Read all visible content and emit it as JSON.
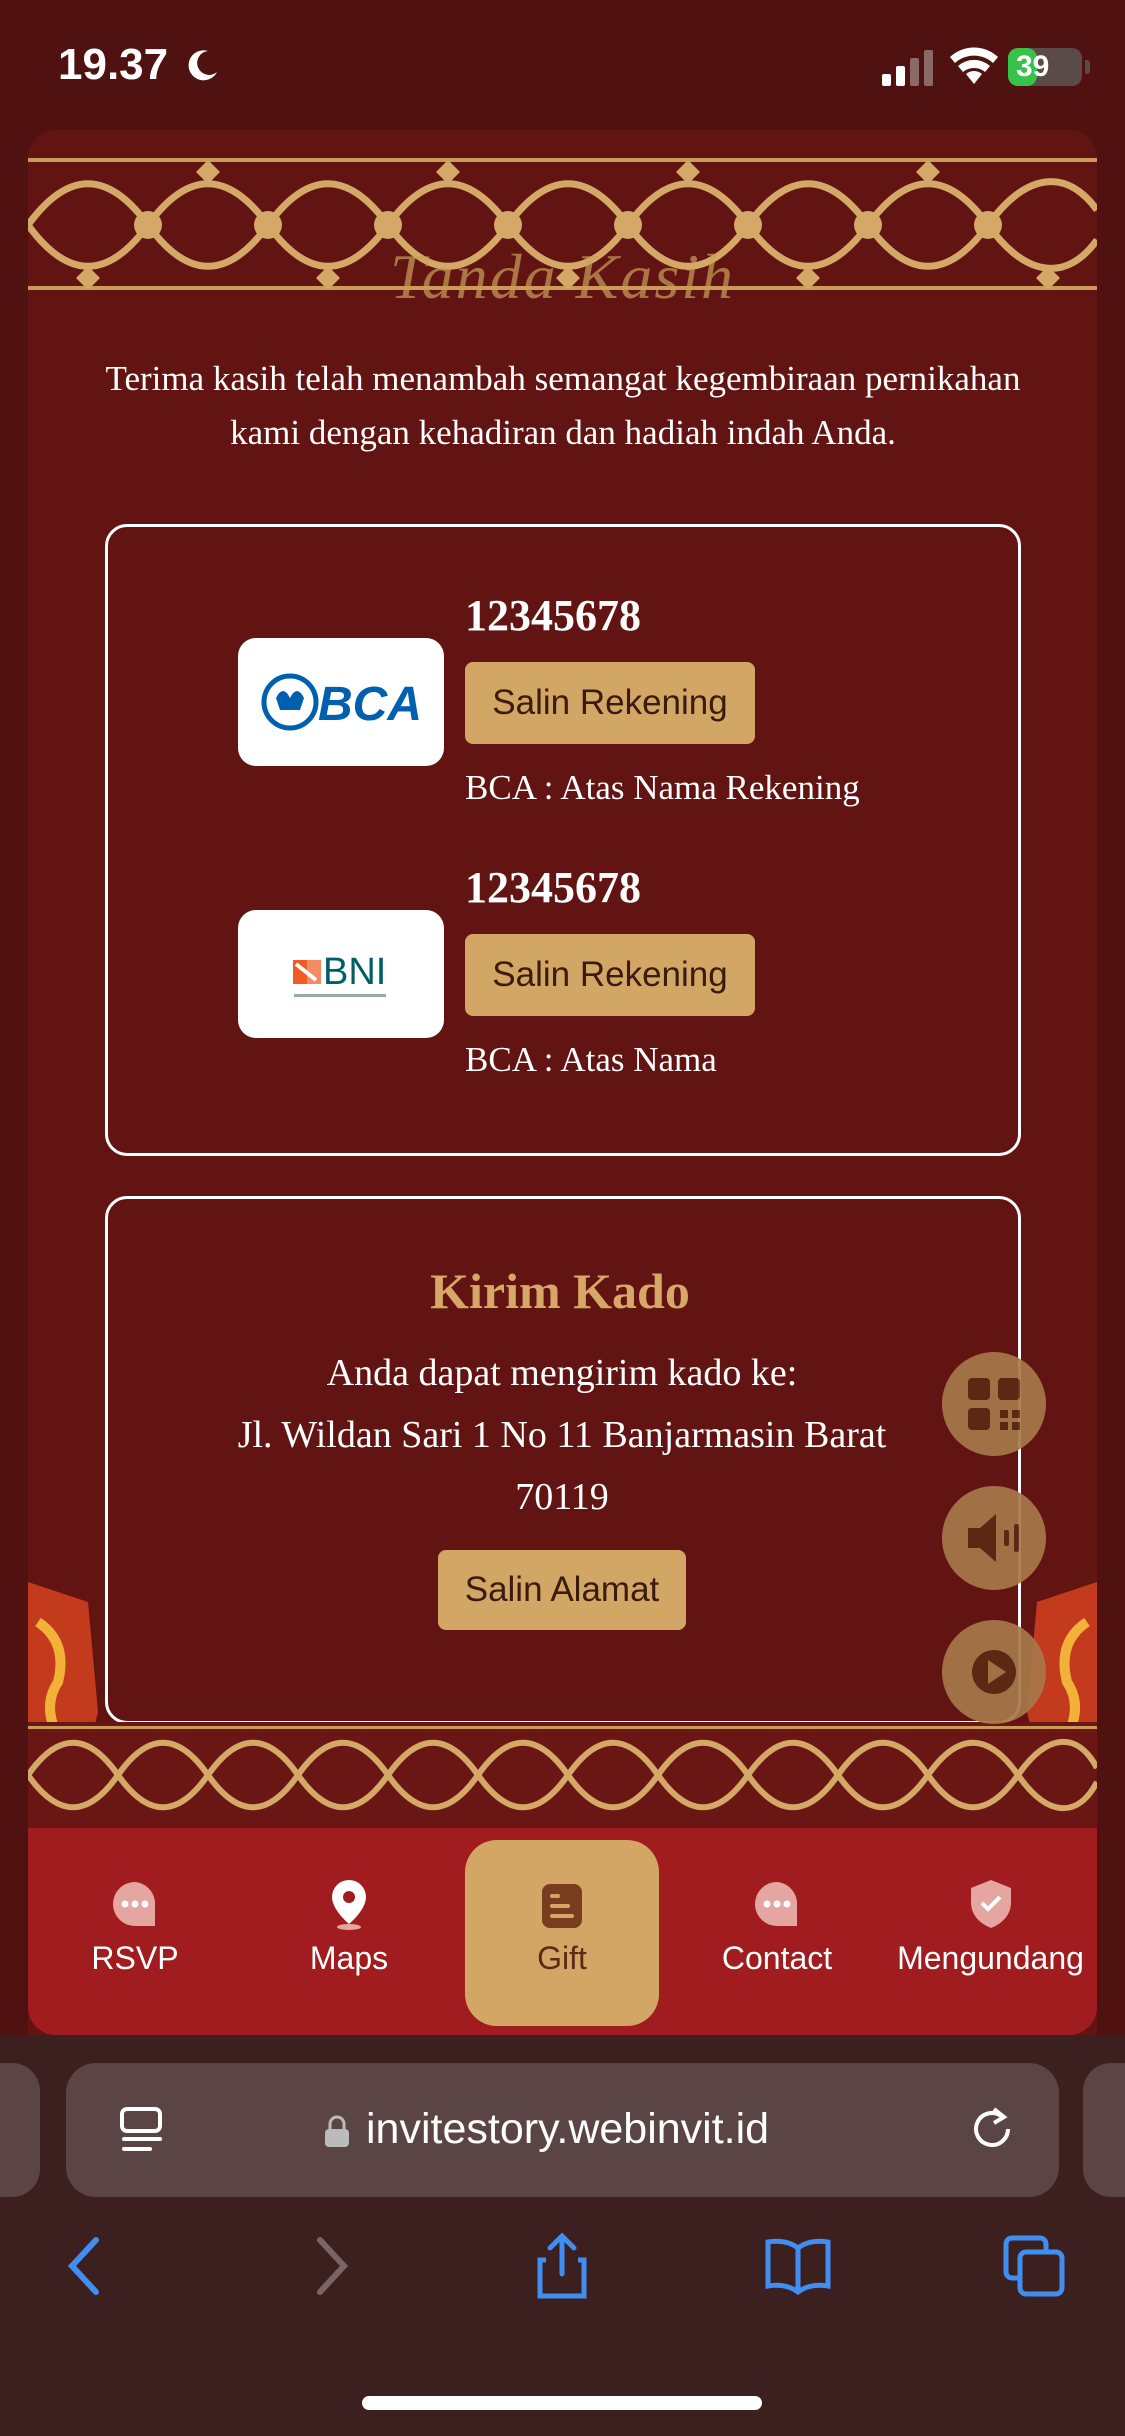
{
  "status_bar": {
    "time": "19.37",
    "battery": "39",
    "battery_level": 0.39
  },
  "section": {
    "title": "Tanda Kasih",
    "intro": "Terima kasih telah menambah semangat kegembiraan pernikahan kami dengan kehadiran dan hadiah indah Anda."
  },
  "accounts": [
    {
      "bank": "BCA",
      "number": "12345678",
      "copy_label": "Salin Rekening",
      "holder": "BCA : Atas Nama Rekening"
    },
    {
      "bank": "BNI",
      "number": "12345678",
      "copy_label": "Salin Rekening",
      "holder": "BCA : Atas Nama"
    }
  ],
  "gift": {
    "title": "Kirim Kado",
    "line1": "Anda dapat mengirim kado ke:",
    "address": "Jl. Wildan Sari 1 No 11 Banjarmasin Barat 70119",
    "copy_label": "Salin Alamat"
  },
  "nav": [
    {
      "label": "RSVP",
      "icon": "chat-bubble-icon"
    },
    {
      "label": "Maps",
      "icon": "map-pin-icon"
    },
    {
      "label": "Gift",
      "icon": "gift-doc-icon",
      "active": true
    },
    {
      "label": "Contact",
      "icon": "chat-bubble-icon"
    },
    {
      "label": "Mengundang",
      "icon": "shield-check-icon"
    }
  ],
  "floating": [
    "qr-code-icon",
    "speaker-icon",
    "play-icon"
  ],
  "browser": {
    "url": "invitestory.webinvit.id"
  },
  "colors": {
    "background": "#621412",
    "gold": "#d2a665",
    "nav": "#a01c1e"
  }
}
